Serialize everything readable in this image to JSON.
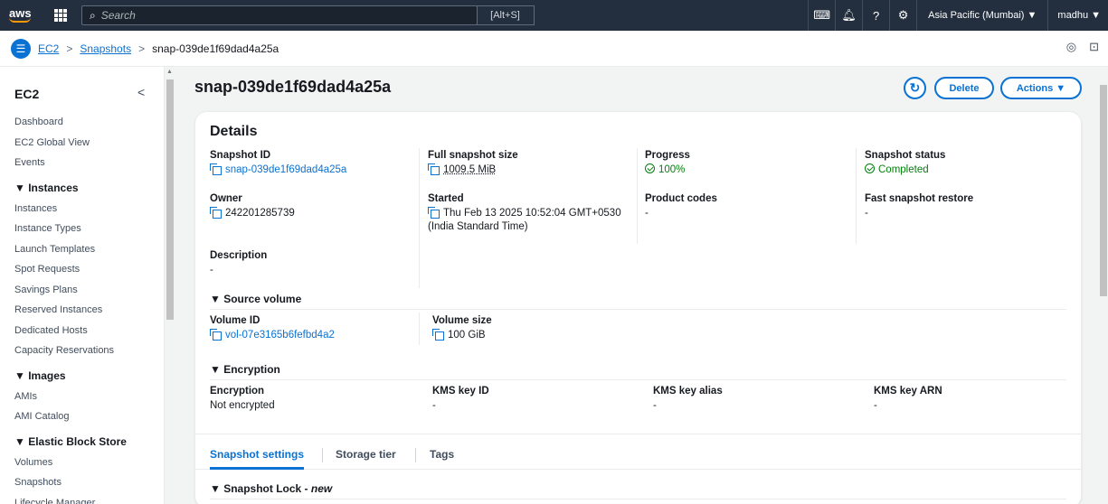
{
  "topbar": {
    "logo": "aws",
    "search_placeholder": "Search",
    "shortcut": "[Alt+S]",
    "region": "Asia Pacific (Mumbai) ▼",
    "user": "madhu ▼"
  },
  "breadcrumb": {
    "items": [
      "EC2",
      "Snapshots"
    ],
    "current": "snap-039de1f69dad4a25a"
  },
  "sidebar": {
    "title": "EC2",
    "top_items": [
      "Dashboard",
      "EC2 Global View",
      "Events"
    ],
    "sections": [
      {
        "title": "▼ Instances",
        "items": [
          "Instances",
          "Instance Types",
          "Launch Templates",
          "Spot Requests",
          "Savings Plans",
          "Reserved Instances",
          "Dedicated Hosts",
          "Capacity Reservations"
        ]
      },
      {
        "title": "▼ Images",
        "items": [
          "AMIs",
          "AMI Catalog"
        ]
      },
      {
        "title": "▼ Elastic Block Store",
        "items": [
          "Volumes",
          "Snapshots",
          "Lifecycle Manager"
        ]
      }
    ]
  },
  "page": {
    "title": "snap-039de1f69dad4a25a",
    "delete_label": "Delete",
    "actions_label": "Actions ▼"
  },
  "details": {
    "title": "Details",
    "snapshot_id": {
      "label": "Snapshot ID",
      "value": "snap-039de1f69dad4a25a"
    },
    "full_size": {
      "label": "Full snapshot size",
      "value": "1009.5 MiB"
    },
    "progress": {
      "label": "Progress",
      "value": "100%"
    },
    "status": {
      "label": "Snapshot status",
      "value": "Completed"
    },
    "owner": {
      "label": "Owner",
      "value": "242201285739"
    },
    "started": {
      "label": "Started",
      "value_line1": "Thu Feb 13 2025 10:52:04 GMT+0530",
      "value_line2": "(India Standard Time)"
    },
    "product_codes": {
      "label": "Product codes",
      "value": "-"
    },
    "fast_restore": {
      "label": "Fast snapshot restore",
      "value": "-"
    },
    "description": {
      "label": "Description",
      "value": "-"
    }
  },
  "source_volume": {
    "title": "▼ Source volume",
    "volume_id": {
      "label": "Volume ID",
      "value": "vol-07e3165b6fefbd4a2"
    },
    "volume_size": {
      "label": "Volume size",
      "value": "100 GiB"
    }
  },
  "encryption": {
    "title": "▼ Encryption",
    "encryption": {
      "label": "Encryption",
      "value": "Not encrypted"
    },
    "kms_key_id": {
      "label": "KMS key ID",
      "value": "-"
    },
    "kms_key_alias": {
      "label": "KMS key alias",
      "value": "-"
    },
    "kms_key_arn": {
      "label": "KMS key ARN",
      "value": "-"
    }
  },
  "tabs": [
    "Snapshot settings",
    "Storage tier",
    "Tags"
  ],
  "snapshot_lock": {
    "title": "▼ Snapshot Lock - ",
    "new_label": "new"
  },
  "colors": {
    "accent": "#0972d3",
    "topbar": "#232f3e",
    "success": "#037f0c"
  }
}
